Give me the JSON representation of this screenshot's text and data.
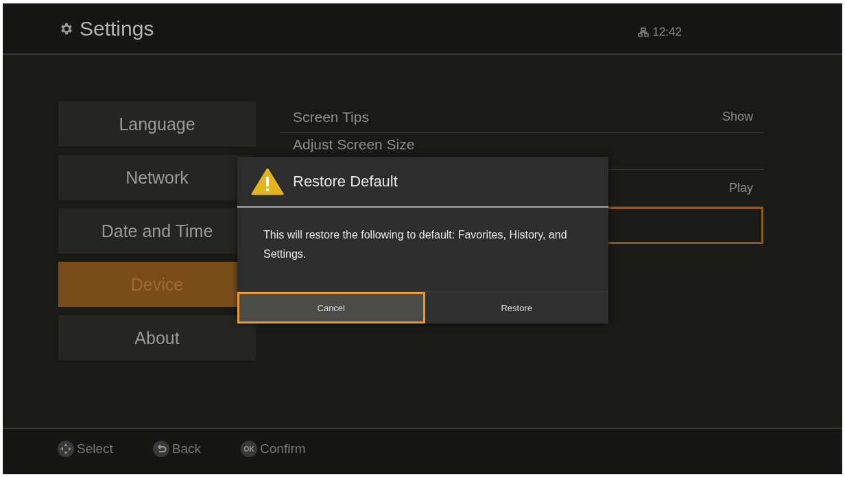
{
  "header": {
    "title": "Settings",
    "time": "12:42"
  },
  "sidebar": {
    "items": [
      {
        "label": "Language",
        "selected": false
      },
      {
        "label": "Network",
        "selected": false
      },
      {
        "label": "Date and Time",
        "selected": false
      },
      {
        "label": "Device",
        "selected": true
      },
      {
        "label": "About",
        "selected": false
      }
    ]
  },
  "settings": {
    "rows": [
      {
        "label": "Screen Tips",
        "value": "Show",
        "selected": false
      },
      {
        "label": "Adjust Screen Size",
        "selected": false
      },
      {
        "value": "Play",
        "selected": false
      },
      {
        "selected": true
      }
    ]
  },
  "dialog": {
    "title": "Restore Default",
    "message": "This will restore the following to default: Favorites, History, and Settings.",
    "buttons": [
      {
        "label": "Cancel",
        "selected": true
      },
      {
        "label": "Restore",
        "selected": false
      }
    ]
  },
  "hints": [
    {
      "kind": "dpad",
      "label": "Select"
    },
    {
      "kind": "back",
      "label": "Back"
    },
    {
      "kind": "ok",
      "key": "OK",
      "label": "Confirm"
    }
  ]
}
